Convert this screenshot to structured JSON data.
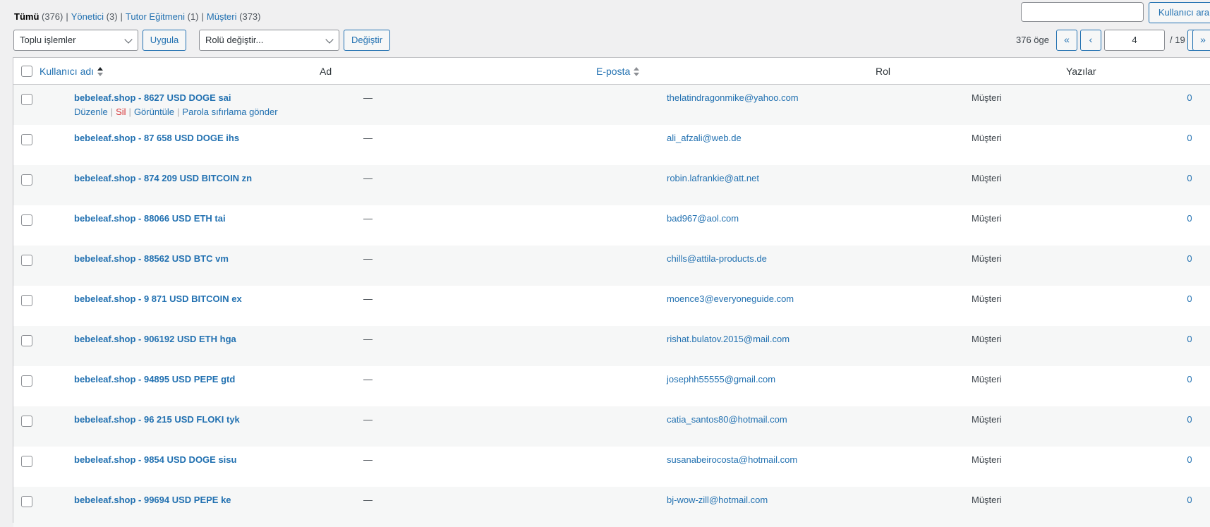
{
  "filters": [
    {
      "label": "Tümü",
      "count": "(376)",
      "current": true
    },
    {
      "label": "Yönetici",
      "count": "(3)",
      "current": false
    },
    {
      "label": "Tutor Eğitmeni",
      "count": "(1)",
      "current": false
    },
    {
      "label": "Müşteri",
      "count": "(373)",
      "current": false
    }
  ],
  "search": {
    "value": "",
    "button_label": "Kullanıcı ara"
  },
  "bulk": {
    "select_value": "Toplu işlemler",
    "apply_label": "Uygula"
  },
  "role_change": {
    "select_value": "Rolü değiştir...",
    "change_label": "Değiştir"
  },
  "pagination": {
    "items_text": "376 öge",
    "first": "«",
    "prev": "‹",
    "current_page": "4",
    "total_text": "/ 19",
    "next": "›",
    "last": "»"
  },
  "columns": {
    "username": "Kullanıcı adı",
    "name": "Ad",
    "email": "E-posta",
    "role": "Rol",
    "posts": "Yazılar"
  },
  "row_actions": {
    "edit": "Düzenle",
    "delete": "Sil",
    "view": "Görüntüle",
    "reset_password": "Parola sıfırlama gönder"
  },
  "users": [
    {
      "username": "bebeleaf.shop - 8627 USD DOGE sai",
      "name": "—",
      "email": "thelatindragonmike@yahoo.com",
      "role": "Müşteri",
      "posts": "0"
    },
    {
      "username": "bebeleaf.shop - 87 658 USD DOGE ihs",
      "name": "—",
      "email": "ali_afzali@web.de",
      "role": "Müşteri",
      "posts": "0"
    },
    {
      "username": "bebeleaf.shop - 874 209 USD BITCOIN zn",
      "name": "—",
      "email": "robin.lafrankie@att.net",
      "role": "Müşteri",
      "posts": "0"
    },
    {
      "username": "bebeleaf.shop - 88066 USD ETH tai",
      "name": "—",
      "email": "bad967@aol.com",
      "role": "Müşteri",
      "posts": "0"
    },
    {
      "username": "bebeleaf.shop - 88562 USD BTC vm",
      "name": "—",
      "email": "chills@attila-products.de",
      "role": "Müşteri",
      "posts": "0"
    },
    {
      "username": "bebeleaf.shop - 9 871 USD BITCOIN ex",
      "name": "—",
      "email": "moence3@everyoneguide.com",
      "role": "Müşteri",
      "posts": "0"
    },
    {
      "username": "bebeleaf.shop - 906192 USD ETH hga",
      "name": "—",
      "email": "rishat.bulatov.2015@mail.com",
      "role": "Müşteri",
      "posts": "0"
    },
    {
      "username": "bebeleaf.shop - 94895 USD PEPE gtd",
      "name": "—",
      "email": "josephh55555@gmail.com",
      "role": "Müşteri",
      "posts": "0"
    },
    {
      "username": "bebeleaf.shop - 96 215 USD FLOKI tyk",
      "name": "—",
      "email": "catia_santos80@hotmail.com",
      "role": "Müşteri",
      "posts": "0"
    },
    {
      "username": "bebeleaf.shop - 9854 USD DOGE sisu",
      "name": "—",
      "email": "susanabeirocosta@hotmail.com",
      "role": "Müşteri",
      "posts": "0"
    },
    {
      "username": "bebeleaf.shop - 99694 USD PEPE ke",
      "name": "—",
      "email": "bj-wow-zill@hotmail.com",
      "role": "Müşteri",
      "posts": "0"
    }
  ]
}
